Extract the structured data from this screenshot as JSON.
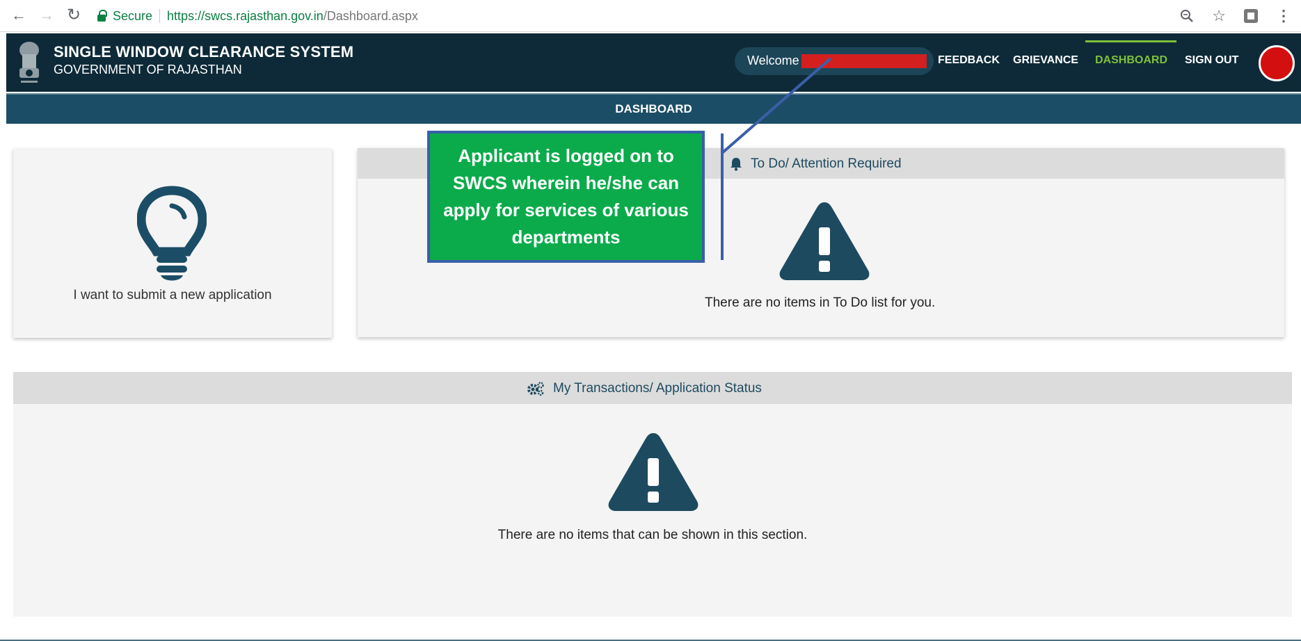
{
  "browser": {
    "secure_label": "Secure",
    "url_base": "https://swcs.rajasthan.gov.in",
    "url_path": "/Dashboard.aspx"
  },
  "header": {
    "title": "SINGLE WINDOW CLEARANCE SYSTEM",
    "subtitle": "GOVERNMENT OF RAJASTHAN",
    "welcome": "Welcome",
    "nav": {
      "feedback": "FEEDBACK",
      "grievance": "GRIEVANCE",
      "dashboard": "DASHBOARD",
      "signout": "SIGN OUT"
    },
    "active_color": "#7ec03a"
  },
  "subheader": {
    "title": "DASHBOARD"
  },
  "new_application": {
    "label": "I want to submit a new application"
  },
  "todo": {
    "title": "To Do/ Attention Required",
    "empty_message": "There are no items in To Do list for you."
  },
  "transactions": {
    "title": "My Transactions/ Application Status",
    "empty_message": "There are no items that can be shown in this section."
  },
  "callout": {
    "text": "Applicant is logged on to SWCS wherein he/she can apply for services of various departments"
  },
  "icons": [
    "back-arrow-icon",
    "forward-arrow-icon",
    "reload-icon",
    "lock-icon",
    "zoom-icon",
    "star-icon",
    "extension-icon",
    "menu-icon",
    "emblem-icon",
    "lightbulb-icon",
    "bell-icon",
    "warning-icon",
    "gears-icon"
  ]
}
